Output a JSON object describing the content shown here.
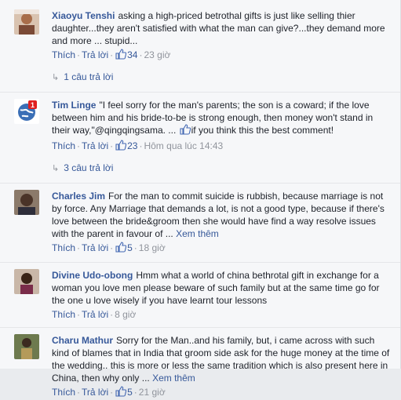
{
  "comments": [
    {
      "author": "Xiaoyu Tenshi",
      "text": "asking a high-priced betrothal gifts is just like selling thier daughter...they aren't satisfied with what the man can give?...they demand more and more ... stupid...",
      "see_more": "",
      "like_label": "Thích",
      "reply_label": "Trả lời",
      "likes": "34",
      "time": "23 giờ",
      "replies": "1 câu trả lời",
      "avatar": "avatar-photo-woman"
    },
    {
      "author": "Tim Linge",
      "text": "\"I feel sorry for the man's parents; the son is a coward; if the love between him and his bride-to-be is strong enough, then money won't stand in their way,\"@qingqingsama. ...",
      "inline_suffix": "if you think this the best comment!",
      "see_more": "",
      "like_label": "Thích",
      "reply_label": "Trả lời",
      "likes": "23",
      "time": "Hôm qua lúc 14:43",
      "replies": "3 câu trả lời",
      "avatar": "avatar-globe-badge",
      "badge": "1"
    },
    {
      "author": "Charles Jim",
      "text": "For the man to commit suicide is rubbish, because marriage is not by force. Any Marriage that demands a lot, is not a good type, because if there's love between the bride&groom then she would have find a way resolve issues with the parent in favour of ...",
      "see_more": "Xem thêm",
      "like_label": "Thích",
      "reply_label": "Trả lời",
      "likes": "5",
      "time": "18 giờ",
      "avatar": "avatar-photo-man"
    },
    {
      "author": "Divine Udo-obong",
      "text": "Hmm what a world of china bethrotal gift in exchange for a woman you love men please beware of such family but at the same time go for the one u love wisely if you have learnt tour lessons",
      "see_more": "",
      "like_label": "Thích",
      "reply_label": "Trả lời",
      "likes": "",
      "time": "8 giờ",
      "avatar": "avatar-photo-woman-2"
    },
    {
      "author": "Charu Mathur",
      "text": "Sorry for the Man..and his family, but, i came across with such kind of blames that in India that groom side ask for the huge money at the time of the wedding.. this is more or less the same tradition which is also present here in China, then why only ...",
      "see_more": "Xem thêm",
      "like_label": "Thích",
      "reply_label": "Trả lời",
      "likes": "5",
      "time": "21 giờ",
      "avatar": "avatar-photo-outdoor"
    }
  ],
  "colors": {
    "link": "#365899",
    "meta": "#90949c",
    "text": "#1d2129",
    "like_blue": "#4267b2"
  }
}
